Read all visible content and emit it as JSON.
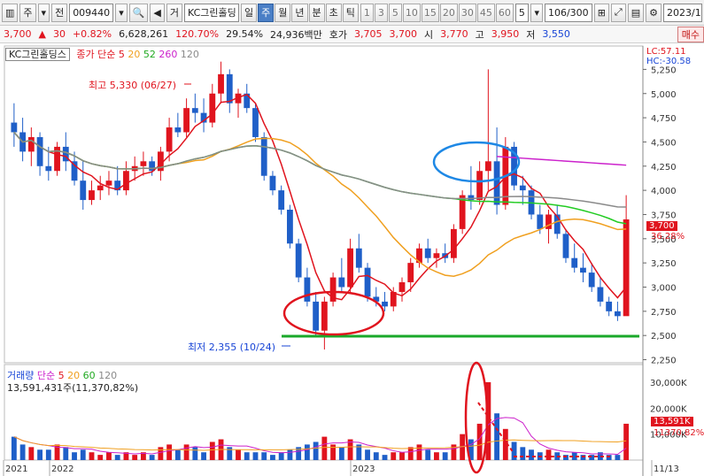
{
  "toolbar": {
    "market_type": "주",
    "prev_btn": "전",
    "stock_code": "009440",
    "view_btn": "거",
    "stock_name": "KC그린홀딩",
    "periods": [
      "일",
      "주",
      "월",
      "년",
      "분",
      "초",
      "틱"
    ],
    "selected_period": "주",
    "numbers": [
      "1",
      "3",
      "5",
      "10",
      "15",
      "20",
      "30",
      "45",
      "60"
    ],
    "interval": "5",
    "count": "106/300",
    "date": "2023/1"
  },
  "quote": {
    "price": "3,700",
    "change": "30",
    "change_pct": "+0.82%",
    "volume": "6,628,261",
    "volume_ratio": "120.70%",
    "turnover_pct": "29.54%",
    "amount": "24,936백만",
    "bid_label": "호가",
    "bid": "3,705",
    "ask": "3,700",
    "open_label": "시",
    "open": "3,770",
    "high_label": "고",
    "high": "3,950",
    "low_label": "저",
    "low": "3,550",
    "buy_btn": "매수"
  },
  "price_legend": {
    "name": "KC그린홀딩스",
    "series_label": "종가 단순",
    "ma": [
      "5",
      "20",
      "52",
      "260",
      "120"
    ]
  },
  "volume_legend": {
    "name": "거래량",
    "series_label": "단순",
    "ma": [
      "5",
      "20",
      "60",
      "120"
    ],
    "value_text": "13,591,431주(11,370,82%)"
  },
  "annotations": {
    "high": "최고 5,330 (06/27)",
    "low": "최저 2,355 (10/24)"
  },
  "right_labels": {
    "lc": "LC:57.11",
    "hc": "HC:-30.58",
    "price_tag": "3,700",
    "price_tag_pct": "36.28%",
    "vol_tag": "13,591K",
    "vol_tag_pct": "11370.82%"
  },
  "colors": {
    "up": "#e0141e",
    "down": "#1f5fc8",
    "ma5": "#e0141e",
    "ma20": "#f0a020",
    "ma52": "#22cc22",
    "ma260": "#cc22cc",
    "ma120": "#8a8a8a"
  },
  "chart_data": {
    "type": "candlestick",
    "price_axis_ticks": [
      2250,
      2500,
      2750,
      3000,
      3250,
      3500,
      3750,
      4000,
      4250,
      4500,
      4750,
      5000,
      5250
    ],
    "volume_axis_ticks": [
      "10,000K",
      "20,000K",
      "30,000K"
    ],
    "x_labels": [
      "2021",
      "2022",
      "2023",
      "11/13"
    ],
    "ohlc": [
      [
        4700,
        4900,
        4450,
        4600
      ],
      [
        4600,
        4750,
        4300,
        4400
      ],
      [
        4400,
        4650,
        4250,
        4550
      ],
      [
        4550,
        4600,
        4150,
        4250
      ],
      [
        4250,
        4450,
        4100,
        4200
      ],
      [
        4200,
        4500,
        4150,
        4450
      ],
      [
        4450,
        4600,
        4200,
        4300
      ],
      [
        4300,
        4400,
        4050,
        4100
      ],
      [
        4100,
        4300,
        3800,
        3900
      ],
      [
        3900,
        4100,
        3850,
        4000
      ],
      [
        4000,
        4150,
        3900,
        4050
      ],
      [
        4050,
        4200,
        3950,
        4100
      ],
      [
        4100,
        4250,
        3950,
        4000
      ],
      [
        4000,
        4300,
        3950,
        4200
      ],
      [
        4200,
        4350,
        4100,
        4250
      ],
      [
        4250,
        4400,
        4150,
        4300
      ],
      [
        4300,
        4350,
        4150,
        4200
      ],
      [
        4200,
        4450,
        4100,
        4400
      ],
      [
        4400,
        4750,
        4300,
        4650
      ],
      [
        4650,
        4800,
        4550,
        4600
      ],
      [
        4600,
        4950,
        4550,
        4850
      ],
      [
        4850,
        5000,
        4700,
        4800
      ],
      [
        4800,
        4950,
        4600,
        4700
      ],
      [
        4700,
        5100,
        4650,
        5000
      ],
      [
        5000,
        5330,
        4900,
        5200
      ],
      [
        5200,
        5250,
        4800,
        4900
      ],
      [
        4900,
        5050,
        4750,
        5000
      ],
      [
        5000,
        5100,
        4800,
        4850
      ],
      [
        4850,
        4900,
        4500,
        4550
      ],
      [
        4550,
        4600,
        4100,
        4150
      ],
      [
        4150,
        4200,
        3950,
        4000
      ],
      [
        4000,
        4050,
        3750,
        3800
      ],
      [
        3800,
        3850,
        3400,
        3450
      ],
      [
        3450,
        3500,
        3050,
        3100
      ],
      [
        3100,
        3200,
        2800,
        2850
      ],
      [
        2850,
        2950,
        2500,
        2550
      ],
      [
        2550,
        2900,
        2355,
        2850
      ],
      [
        2850,
        3150,
        2800,
        3100
      ],
      [
        3100,
        3300,
        2950,
        3000
      ],
      [
        3000,
        3500,
        2950,
        3400
      ],
      [
        3400,
        3550,
        3150,
        3200
      ],
      [
        3200,
        3250,
        2850,
        2900
      ],
      [
        2900,
        3000,
        2800,
        2850
      ],
      [
        2850,
        2950,
        2750,
        2800
      ],
      [
        2800,
        3000,
        2750,
        2950
      ],
      [
        2950,
        3100,
        2850,
        3050
      ],
      [
        3050,
        3300,
        2950,
        3250
      ],
      [
        3250,
        3450,
        3200,
        3400
      ],
      [
        3400,
        3500,
        3250,
        3300
      ],
      [
        3300,
        3400,
        3200,
        3350
      ],
      [
        3350,
        3450,
        3250,
        3300
      ],
      [
        3300,
        3650,
        3250,
        3600
      ],
      [
        3600,
        4000,
        3550,
        3950
      ],
      [
        3950,
        4250,
        3800,
        3900
      ],
      [
        3900,
        4300,
        3850,
        4200
      ],
      [
        4200,
        5250,
        4000,
        4300
      ],
      [
        4300,
        4650,
        3750,
        3850
      ],
      [
        3850,
        4550,
        3800,
        4450
      ],
      [
        4450,
        4500,
        4000,
        4050
      ],
      [
        4050,
        4150,
        3850,
        4000
      ],
      [
        4000,
        4050,
        3700,
        3750
      ],
      [
        3750,
        3850,
        3550,
        3600
      ],
      [
        3600,
        3800,
        3450,
        3750
      ],
      [
        3750,
        3850,
        3500,
        3550
      ],
      [
        3550,
        3600,
        3250,
        3300
      ],
      [
        3300,
        3450,
        3150,
        3200
      ],
      [
        3200,
        3350,
        3050,
        3150
      ],
      [
        3150,
        3250,
        2950,
        3000
      ],
      [
        3000,
        3100,
        2800,
        2850
      ],
      [
        2850,
        2900,
        2700,
        2750
      ],
      [
        2750,
        2850,
        2650,
        2700
      ],
      [
        2700,
        3950,
        3550,
        3700
      ]
    ],
    "volume": [
      9,
      6,
      5,
      4,
      4,
      6,
      5,
      3,
      4,
      3,
      2,
      3,
      2,
      3,
      2,
      3,
      2,
      5,
      6,
      4,
      6,
      5,
      3,
      7,
      8,
      5,
      4,
      3,
      3,
      3,
      2,
      3,
      4,
      5,
      6,
      7,
      9,
      6,
      5,
      8,
      6,
      4,
      3,
      2,
      3,
      3,
      5,
      6,
      4,
      3,
      3,
      6,
      10,
      8,
      14,
      30,
      18,
      12,
      7,
      5,
      4,
      3,
      4,
      3,
      2,
      3,
      2,
      2,
      3,
      2,
      2,
      14
    ],
    "volume_unit": "K"
  }
}
